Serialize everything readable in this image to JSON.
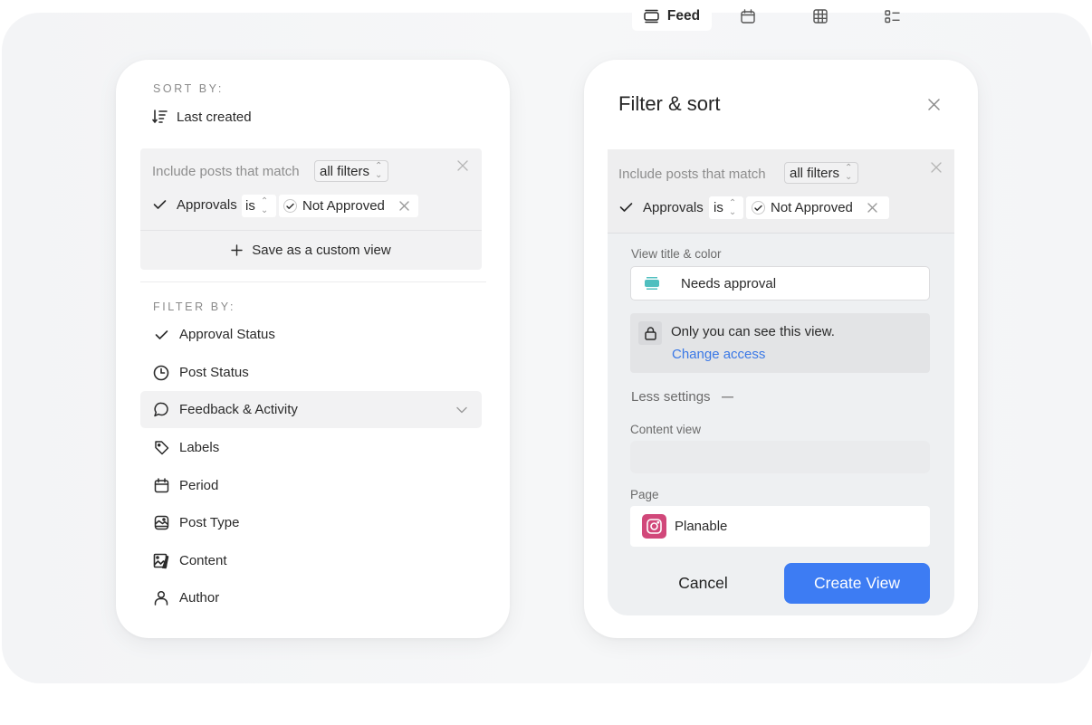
{
  "left_panel": {
    "sort_label": "SORT BY:",
    "sort_value": "Last created",
    "sort_icon": "sort-descending-icon",
    "filter_box": {
      "match_prefix": "Include posts that match",
      "match_mode": "all filters",
      "condition": {
        "field": "Approvals",
        "operator": "is",
        "value": "Not Approved"
      },
      "save_custom_view": "Save as a custom view"
    },
    "filter_label": "FILTER BY:",
    "filter_items": [
      {
        "label": "Approval Status",
        "icon": "check-icon"
      },
      {
        "label": "Post Status",
        "icon": "clock-icon"
      },
      {
        "label": "Feedback & Activity",
        "icon": "comment-icon",
        "highlighted": true,
        "expandable": true
      },
      {
        "label": "Labels",
        "icon": "tag-icon"
      },
      {
        "label": "Period",
        "icon": "calendar-icon"
      },
      {
        "label": "Post Type",
        "icon": "image-frame-icon"
      },
      {
        "label": "Content",
        "icon": "content-image-icon"
      },
      {
        "label": "Author",
        "icon": "user-icon"
      }
    ]
  },
  "right_panel": {
    "title": "Filter & sort",
    "filter_box": {
      "match_prefix": "Include posts that match",
      "match_mode": "all filters",
      "condition": {
        "field": "Approvals",
        "operator": "is",
        "value": "Not Approved"
      }
    },
    "view_title_label": "View title & color",
    "view_title_value": "Needs approval",
    "view_color": "#4fbfbf",
    "access_text": "Only you can see this view.",
    "access_link": "Change access",
    "less_settings": "Less settings",
    "content_view_label": "Content view",
    "content_views": [
      {
        "label": "Feed",
        "icon": "feed-icon",
        "active": true
      },
      {
        "label": "",
        "icon": "calendar-icon",
        "active": false
      },
      {
        "label": "",
        "icon": "grid-icon",
        "active": false
      },
      {
        "label": "",
        "icon": "list-icon",
        "active": false
      }
    ],
    "page_label": "Page",
    "page_value": "Planable",
    "page_network": "instagram",
    "page_network_color": "#d1487a",
    "cancel_label": "Cancel",
    "create_label": "Create View",
    "primary_color": "#3d7cf3"
  }
}
